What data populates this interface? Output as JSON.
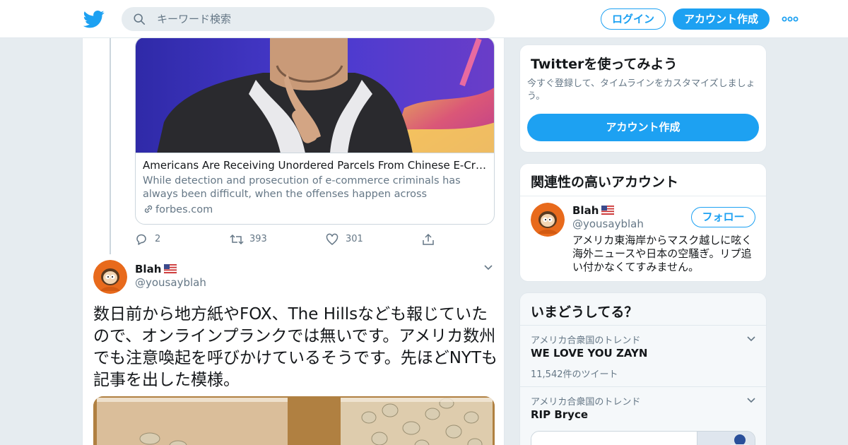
{
  "header": {
    "search_placeholder": "キーワード検索",
    "login_label": "ログイン",
    "signup_label": "アカウント作成"
  },
  "colors": {
    "brand_blue": "#1da1f2",
    "background": "#e6ecf0",
    "text_secondary": "#657786"
  },
  "icons": [
    "twitter-bird-icon",
    "search-icon",
    "more-icon",
    "link-icon",
    "reply-icon",
    "retweet-icon",
    "like-icon",
    "share-icon",
    "chevron-down-icon",
    "us-flag-icon"
  ],
  "timeline": {
    "link_card": {
      "title": "Americans Are Receiving Unordered Parcels From Chinese E-Criminal...",
      "description": "While detection and prosecution of e-commerce criminals has always been difficult, when the offenses happen across international borders all...",
      "domain": "forbes.com"
    },
    "actions": {
      "replies": "2",
      "retweets": "393",
      "likes": "301"
    },
    "tweet": {
      "name": "Blah",
      "handle": "@yousayblah",
      "text": "数日前から地方紙やFOX、The Hillsなども報じていたので、オンラインプランクでは無いです。アメリカ数州でも注意喚起を呼びかけているそうです。先ほどNYTも記事を出した模様。"
    }
  },
  "sidebar": {
    "signup_box": {
      "title": "Twitterを使ってみよう",
      "subtitle": "今すぐ登録して、タイムラインをカスタマイズしましょう。",
      "button": "アカウント作成"
    },
    "related": {
      "title": "関連性の高いアカウント",
      "name": "Blah",
      "handle": "@yousayblah",
      "follow_label": "フォロー",
      "bio": "アメリカ東海岸からマスク越しに呟く海外ニュースや日本の空騒ぎ。リプ追い付かなくてすみません。"
    },
    "trends": {
      "title": "いまどうしてる？",
      "items": [
        {
          "context": "アメリカ合衆国のトレンド",
          "name": "WE LOVE YOU ZAYN",
          "count": "11,542件のツイート"
        },
        {
          "context": "アメリカ合衆国のトレンド",
          "name": "RIP Bryce"
        }
      ]
    }
  }
}
